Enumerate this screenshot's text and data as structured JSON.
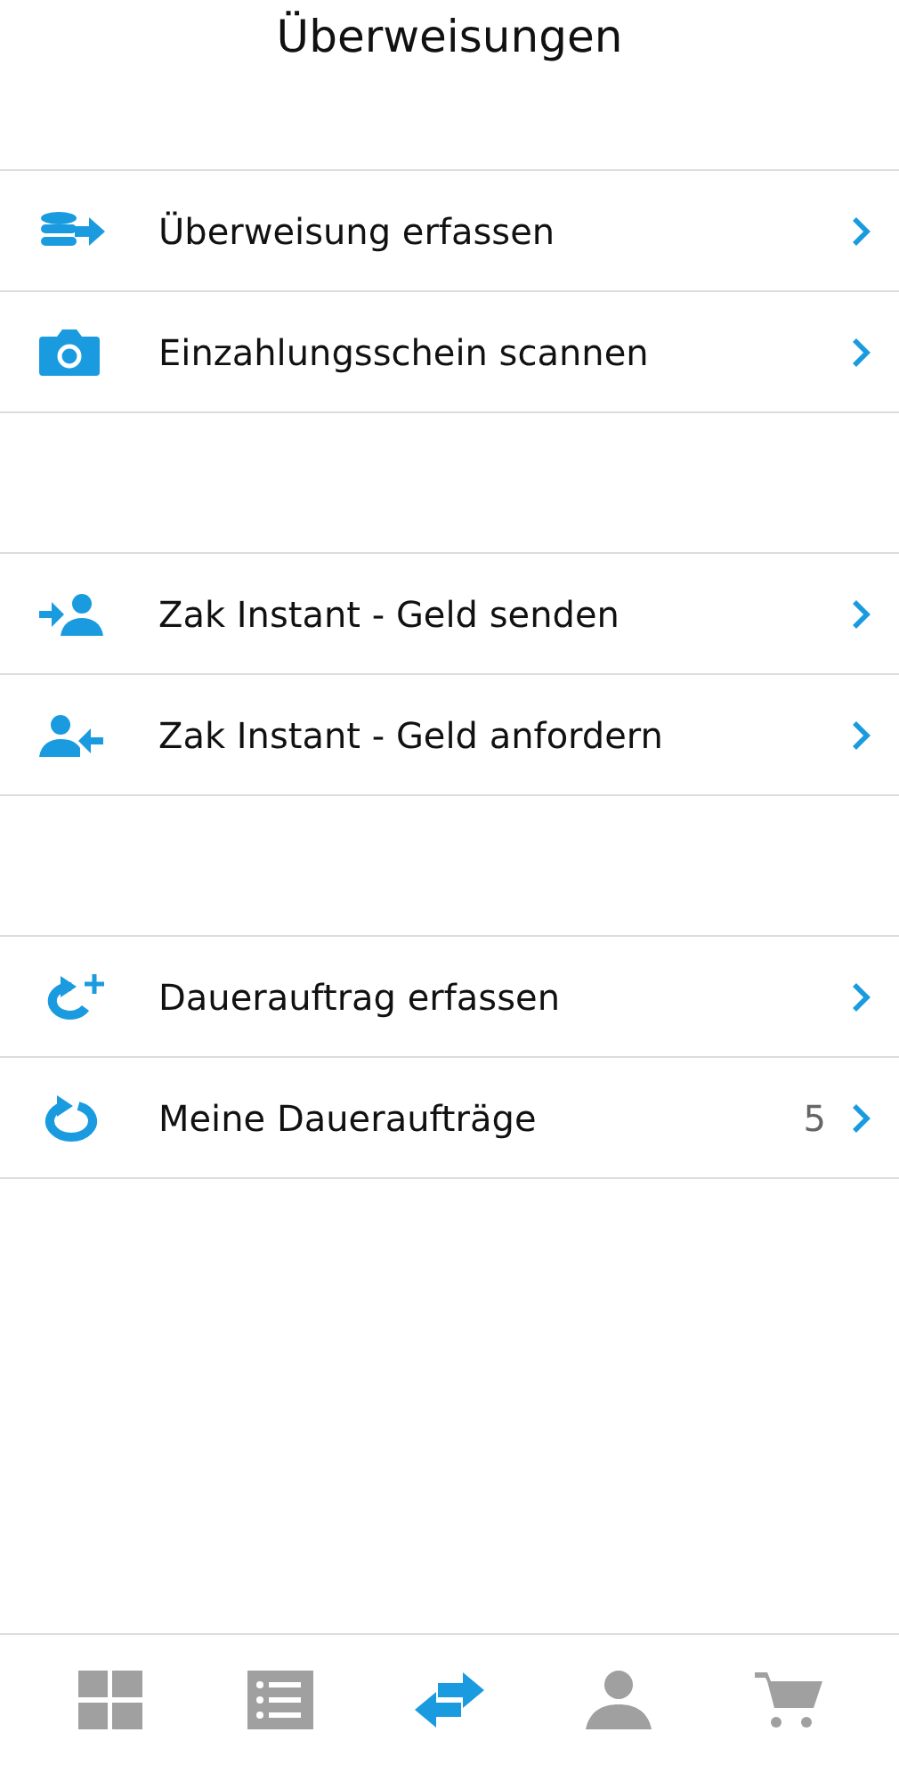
{
  "title": "Überweisungen",
  "sections": [
    {
      "items": [
        {
          "kind": "coins",
          "label": "Überweisung erfassen"
        },
        {
          "kind": "camera",
          "label": "Einzahlungsschein scannen"
        }
      ]
    },
    {
      "items": [
        {
          "kind": "send",
          "label": "Zak Instant - Geld senden"
        },
        {
          "kind": "request",
          "label": "Zak Instant - Geld anfordern"
        }
      ]
    },
    {
      "items": [
        {
          "kind": "repeat-add",
          "label": "Dauerauftrag erfassen"
        },
        {
          "kind": "repeat",
          "label": "Meine Daueraufträge",
          "count": "5"
        }
      ]
    }
  ],
  "tabs": [
    {
      "kind": "dashboard",
      "selected": false
    },
    {
      "kind": "list",
      "selected": false
    },
    {
      "kind": "transfer",
      "selected": true
    },
    {
      "kind": "profile",
      "selected": false
    },
    {
      "kind": "cart",
      "selected": false
    }
  ]
}
